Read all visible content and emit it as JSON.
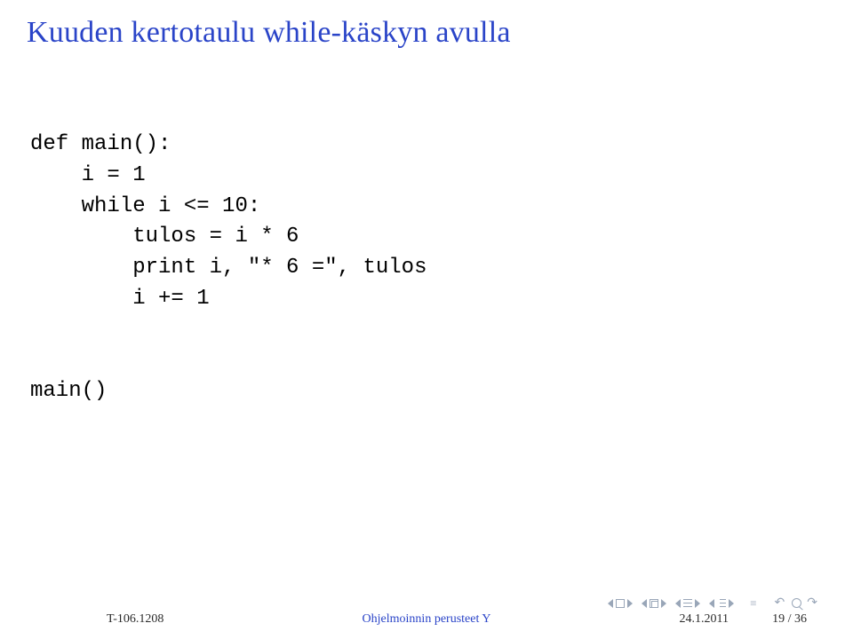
{
  "title": "Kuuden kertotaulu while-käskyn avulla",
  "code": "def main():\n    i = 1\n    while i <= 10:\n        tulos = i * 6\n        print i, \"* 6 =\", tulos\n        i += 1\n\n\nmain()",
  "footer": {
    "course": "T-106.1208",
    "topic": "Ohjelmoinnin perusteet Y",
    "date": "24.1.2011",
    "page": "19 / 36"
  }
}
